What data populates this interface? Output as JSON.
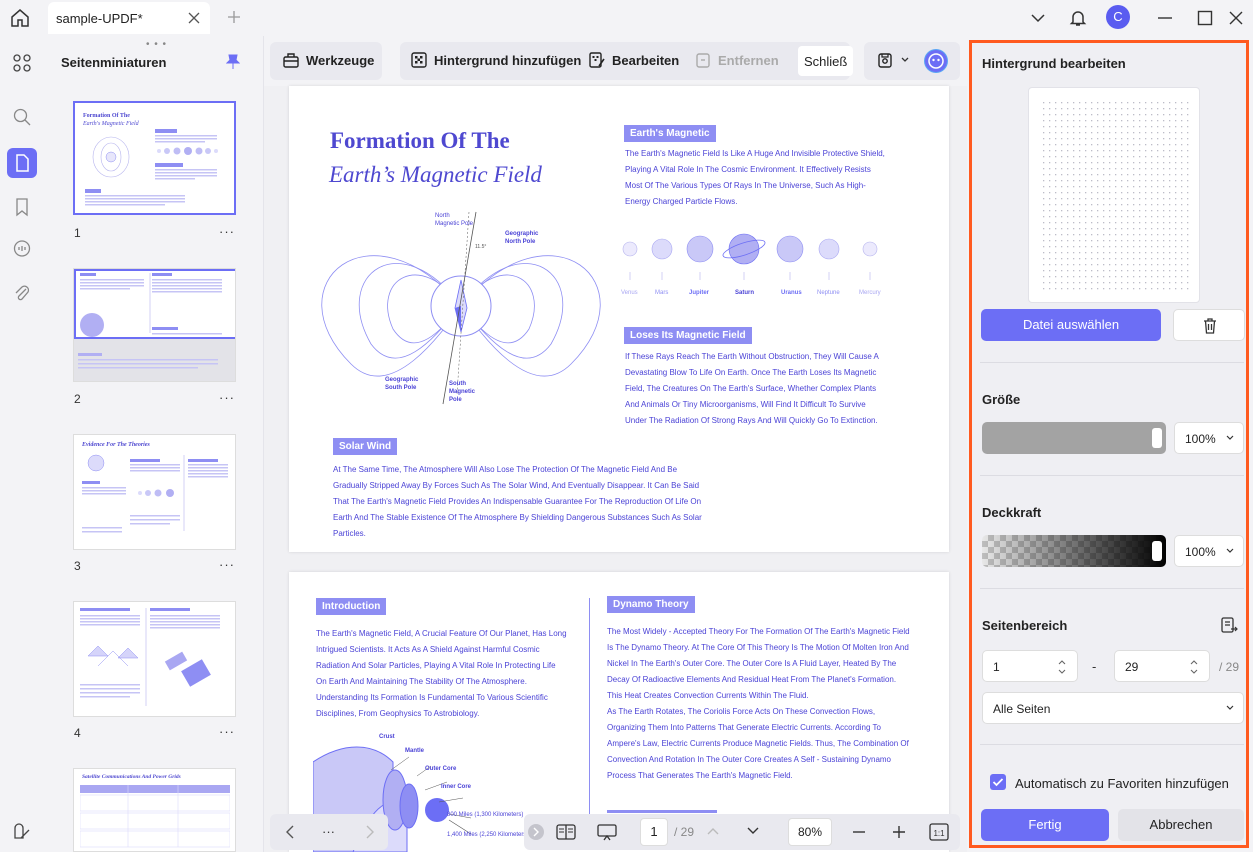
{
  "titlebar": {
    "tab_title": "sample-UPDF*",
    "avatar_letter": "C"
  },
  "thumbnails": {
    "title": "Seitenminiaturen",
    "pages": [
      {
        "num": "1",
        "heading": "Formation Of The",
        "subheading": "Earth's Magnetic Field"
      },
      {
        "num": "2",
        "heading": "",
        "subheading": ""
      },
      {
        "num": "3",
        "heading": "Evidence For The Theories",
        "subheading": ""
      },
      {
        "num": "4",
        "heading": "",
        "subheading": ""
      },
      {
        "num": "",
        "heading": "Satellite Communications And Power Grids",
        "subheading": ""
      }
    ],
    "more": "···"
  },
  "toolbar": {
    "tools_label": "Werkzeuge",
    "add_bg_label": "Hintergrund hinzufügen",
    "edit_label": "Bearbeiten",
    "remove_label": "Entfernen",
    "close_label": "Schließ"
  },
  "page1": {
    "title_line1": "Formation Of The",
    "title_line2": "Earth’s Magnetic Field",
    "north_label": "North\nMagnetic Pole",
    "geo_north": "Geographic\nNorth Pole",
    "geo_south": "Geographic\nSouth Pole",
    "south_mag": "South\nMagnetic\nPole",
    "angle": "11.5°",
    "magnetic_label": "Earth's Magnetic",
    "magnetic_text": "The Earth's Magnetic Field Is Like A Huge And Invisible Protective Shield, Playing A Vital Role In The Cosmic Environment. It Effectively Resists Most Of The Various Types Of Rays In The Universe, Such As High-Energy Charged Particle Flows.",
    "planets": [
      "Venus",
      "Mars",
      "Jupiter",
      "Saturn",
      "Uranus",
      "Neptune",
      "Mercury"
    ],
    "loses_label": "Loses Its Magnetic Field",
    "loses_text": "If These Rays Reach The Earth Without Obstruction, They Will Cause A Devastating Blow To Life On Earth. Once The Earth Loses Its Magnetic Field, The Creatures On The Earth's Surface, Whether Complex Plants And Animals Or Tiny Microorganisms, Will Find It Difficult To Survive Under The Radiation Of Strong Rays And Will Quickly Go To Extinction.",
    "wind_label": "Solar Wind",
    "wind_text": "At The Same Time, The Atmosphere Will Also Lose The Protection Of The Magnetic Field And Be Gradually Stripped Away By Forces Such As The Solar Wind, And Eventually Disappear. It Can Be Said That The Earth's Magnetic Field Provides An Indispensable Guarantee For The Reproduction Of Life On Earth And The Stable Existence Of The Atmosphere By Shielding Dangerous Substances Such As Solar Particles."
  },
  "page2": {
    "intro_label": "Introduction",
    "intro_text": "The Earth's Magnetic Field, A Crucial Feature Of Our Planet, Has Long Intrigued Scientists. It Acts As A Shield Against Harmful Cosmic Radiation And Solar Particles, Playing A Vital Role In Protecting Life On Earth And Maintaining The Stability Of The Atmosphere. Understanding Its Formation Is Fundamental To Various Scientific Disciplines, From Geophysics To Astrobiology.",
    "dynamo_label": "Dynamo Theory",
    "dynamo_text": "The Most Widely - Accepted Theory For The Formation Of The Earth's Magnetic Field Is The Dynamo Theory. At The Core Of This Theory Is The Motion Of Molten Iron And Nickel In The Earth's Outer Core. The Outer Core Is A Fluid Layer, Heated By The Decay Of Radioactive Elements And Residual Heat From The Planet's Formation. This Heat Creates Convection Currents Within The Fluid.",
    "dynamo_text2": "As The Earth Rotates, The Coriolis Force Acts On These Convection Flows, Organizing Them Into Patterns That Generate Electric Currents. According To Ampere's Law, Electric Currents Produce Magnetic Fields. Thus, The Combination Of Convection And Rotation In The Outer Core Creates A Self - Sustaining Dynamo Process That Generates The Earth's Magnetic Field.",
    "crust": "Crust",
    "mantle": "Mantle",
    "outer_core": "Outer Core",
    "inner_core": "Inner Core",
    "miles1": "800 Miles (1,300 Kilometers)",
    "miles2": "1,400 Miles (2,250 Kilometers)"
  },
  "bottom": {
    "more": "···",
    "page_current": "1",
    "page_total": "/ 29",
    "zoom": "80%"
  },
  "panel": {
    "title": "Hintergrund bearbeiten",
    "choose_file": "Datei auswählen",
    "size_title": "Größe",
    "size_value": "100%",
    "opacity_title": "Deckkraft",
    "opacity_value": "100%",
    "range_title": "Seitenbereich",
    "range_from": "1",
    "range_dash": "-",
    "range_to": "29",
    "range_total": "/ 29",
    "all_pages": "Alle Seiten",
    "auto_fav": "Automatisch zu Favoriten hinzufügen",
    "done": "Fertig",
    "cancel": "Abbrechen"
  },
  "colors": {
    "accent": "#6c6ef5",
    "highlight": "#ff5a1f",
    "doc_text": "#4b43d6"
  }
}
